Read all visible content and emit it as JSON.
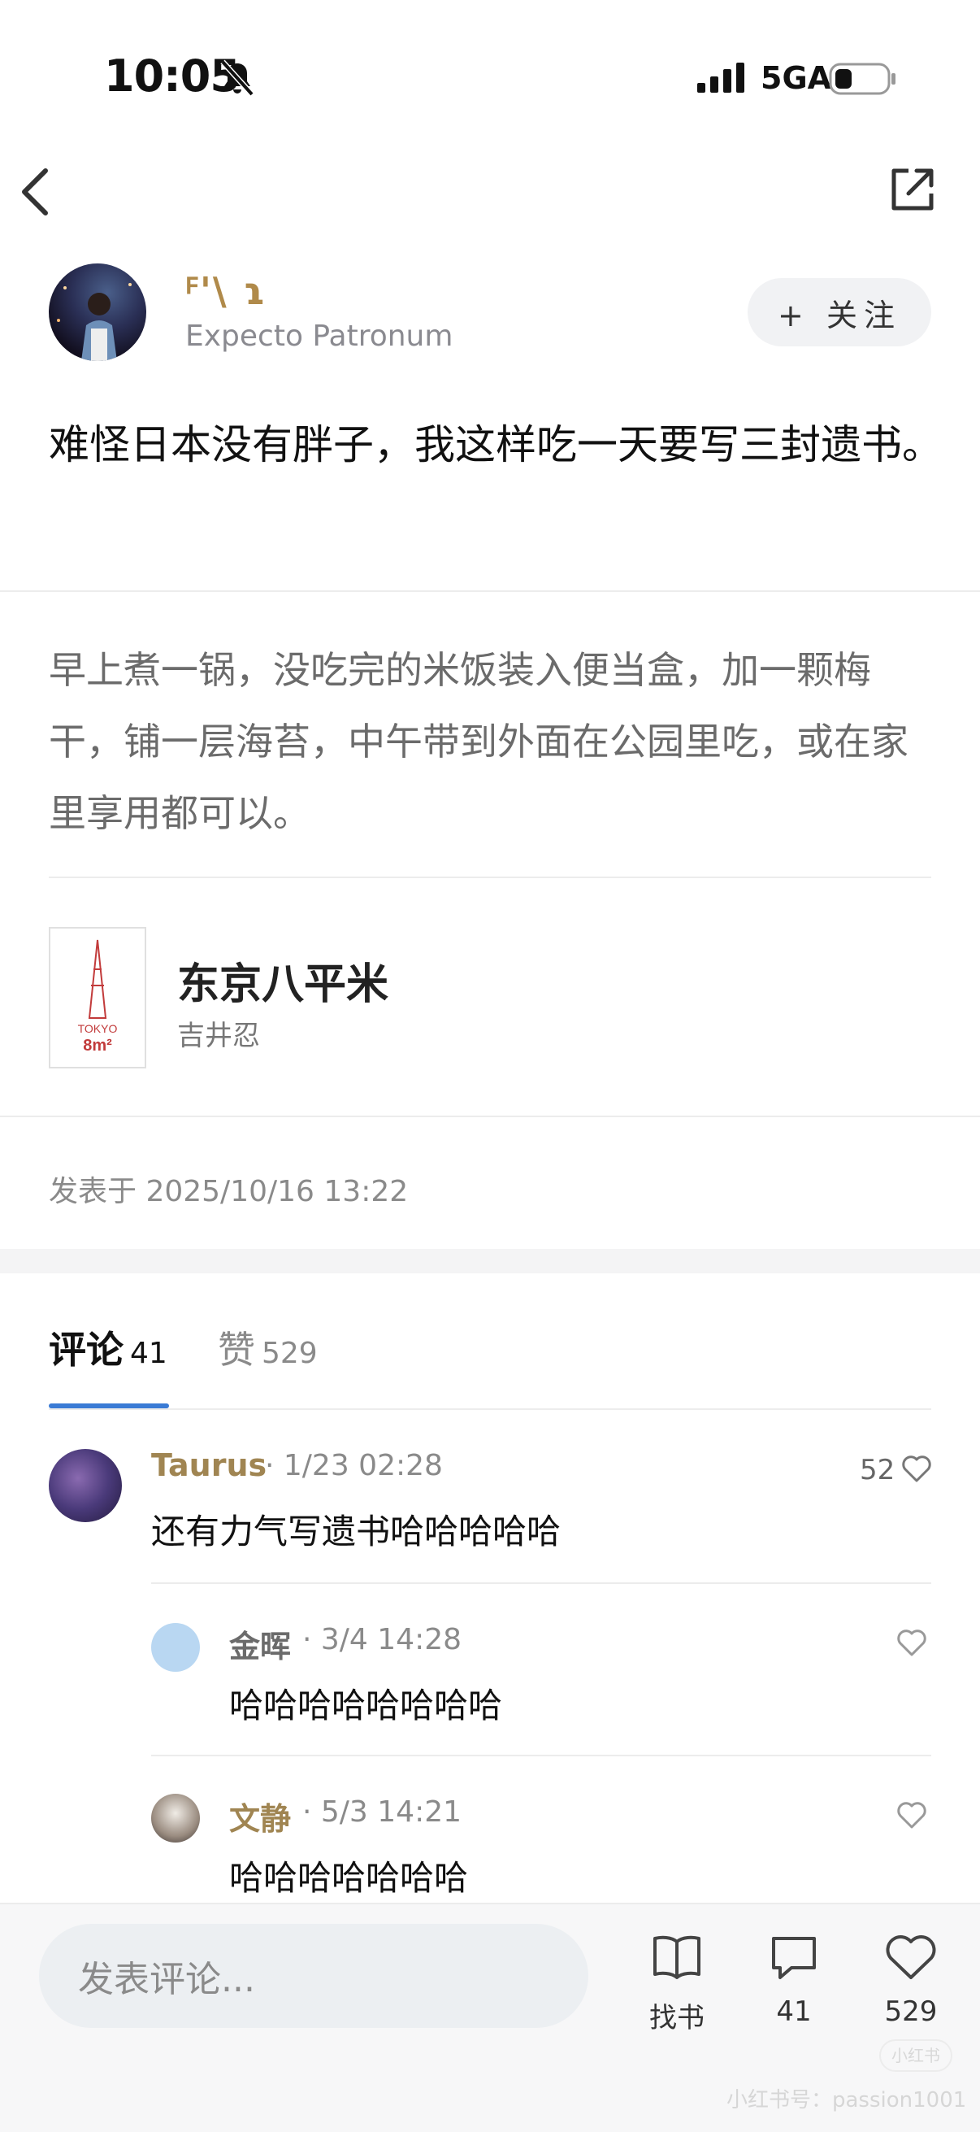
{
  "status_bar": {
    "time": "10:05",
    "network": "5GA"
  },
  "author": {
    "name": "ꟳ'\\ ɿ",
    "subtitle": "Expecto Patronum",
    "follow_label": "+ 关注"
  },
  "post": {
    "title": "难怪日本没有胖子，我这样吃一天要写三封遗书。",
    "body": "早上煮一锅，没吃完的米饭装入便当盒，加一颗梅干，铺一层海苔，中午带到外面在公园里吃，或在家里享用都可以。",
    "book": {
      "title": "东京八平米",
      "author": "吉井忍",
      "cover_text": "TOKYO 8m²"
    },
    "published": "发表于 2025/10/16 13:22"
  },
  "tabs": {
    "comments": {
      "label": "评论",
      "count": "41"
    },
    "likes": {
      "label": "赞",
      "count": "529"
    }
  },
  "comments": [
    {
      "name": "Taurus",
      "time": "· 1/23 02:28",
      "text": "还有力气写遗书哈哈哈哈哈",
      "likes": "52",
      "name_color": "#a08552"
    },
    {
      "name": "金晖",
      "time": "· 3/4 14:28",
      "text": "哈哈哈哈哈哈哈哈",
      "likes": "",
      "name_color": "#6b6b6b"
    },
    {
      "name": "文静",
      "time": "· 5/3 14:21",
      "text": "哈哈哈哈哈哈哈",
      "likes": "",
      "name_color": "#a08552"
    }
  ],
  "bottom_bar": {
    "input_placeholder": "发表评论...",
    "book_label": "找书",
    "comment_count": "41",
    "like_count": "529"
  },
  "watermark": {
    "text": "小红书号：passion1001",
    "badge": "小红书"
  }
}
